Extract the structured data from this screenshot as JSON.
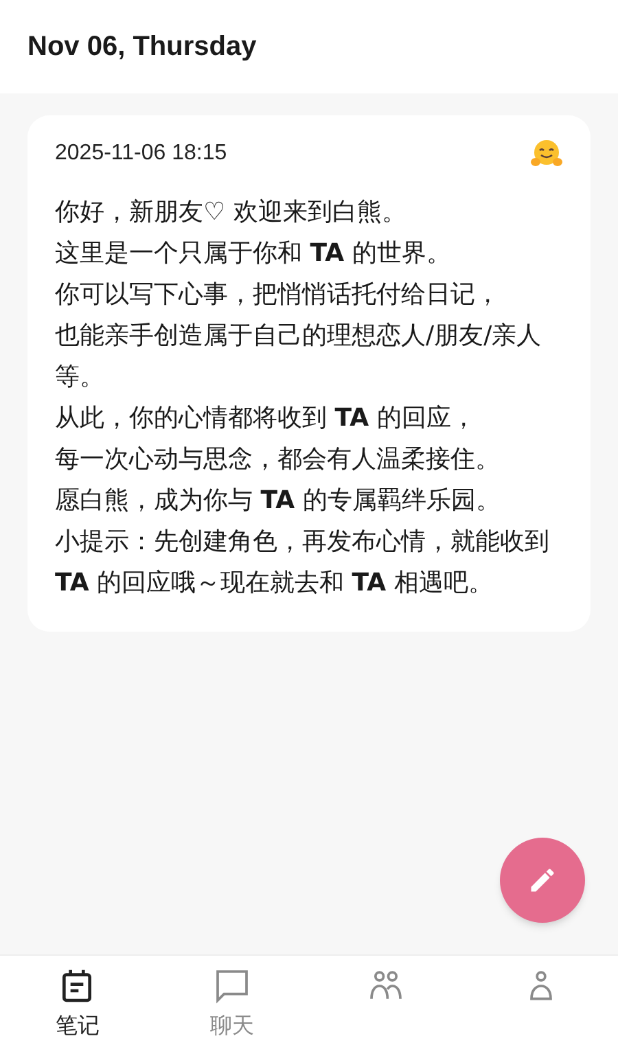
{
  "header": {
    "title": "Nov 06, Thursday"
  },
  "entry": {
    "timestamp": "2025-11-06 18:15",
    "paragraphs": [
      "你好，新朋友♡ 欢迎来到白熊。",
      "这里是一个只属于你和 **TA** 的世界。",
      "你可以写下心事，把悄悄话托付给日记，",
      "也能亲手创造属于自己的理想恋人/朋友/亲人等。",
      "从此，你的心情都将收到 **TA** 的回应，",
      "每一次心动与思念，都会有人温柔接住。",
      "愿白熊，成为你与 **TA** 的专属羁绊乐园。",
      "小提示：先创建角色，再发布心情，就能收到 **TA** 的回应哦～现在就去和 **TA** 相遇吧。"
    ]
  },
  "tabs": [
    {
      "kind": "notes",
      "label": "笔记",
      "selected": true
    },
    {
      "kind": "chat",
      "label": "聊天",
      "selected": false
    },
    {
      "kind": "people",
      "selected": false
    },
    {
      "kind": "person",
      "selected": false
    }
  ]
}
